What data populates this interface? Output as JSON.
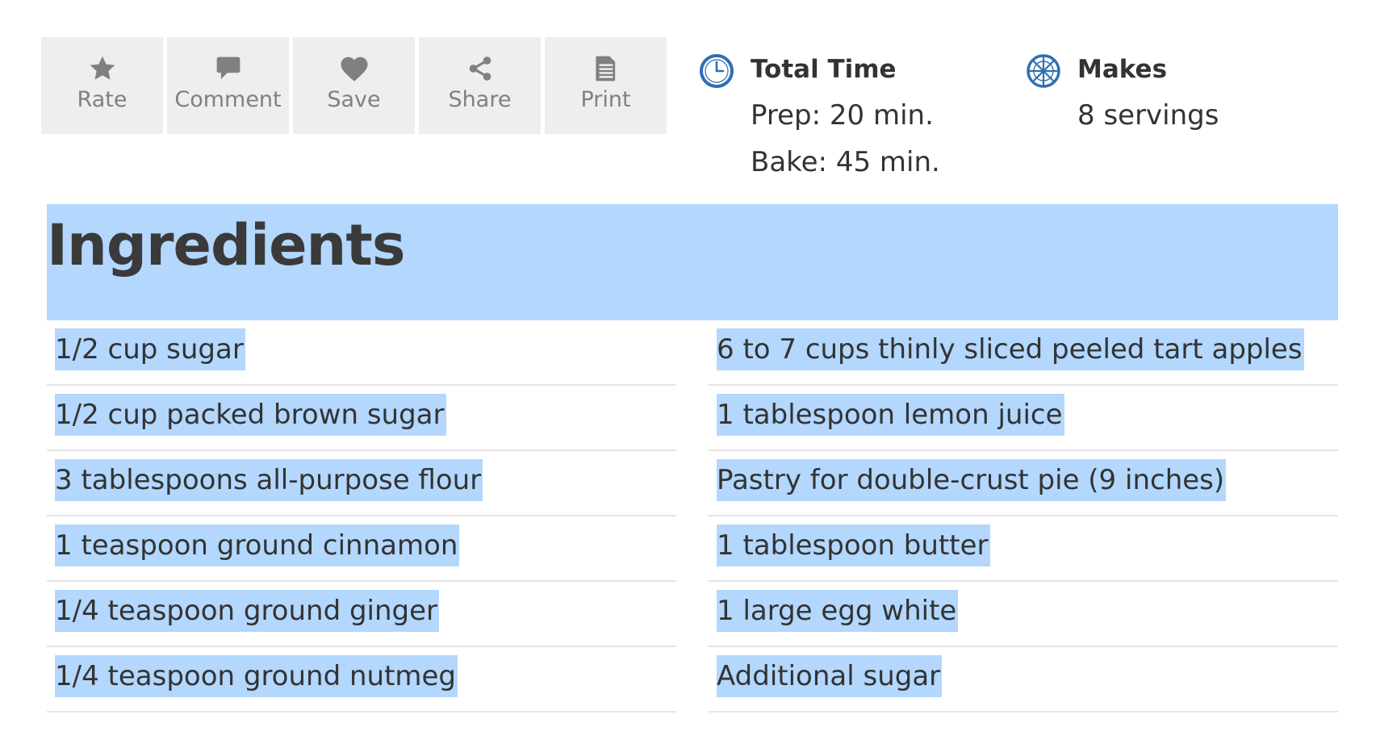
{
  "toolbar": {
    "buttons": [
      {
        "label": "Rate",
        "icon": "star-icon"
      },
      {
        "label": "Comment",
        "icon": "comment-icon"
      },
      {
        "label": "Save",
        "icon": "heart-icon"
      },
      {
        "label": "Share",
        "icon": "share-icon"
      },
      {
        "label": "Print",
        "icon": "print-icon"
      }
    ],
    "icon_color": "#808080",
    "button_bg": "#eeeeee"
  },
  "total_time": {
    "heading": "Total Time",
    "value": "Prep: 20 min. Bake: 45 min.",
    "icon": "clock-icon",
    "icon_color": "#2f6fb3"
  },
  "makes": {
    "heading": "Makes",
    "value": "8 servings",
    "icon": "pie-servings-icon",
    "icon_color": "#2f6fb3"
  },
  "ingredients": {
    "title": "Ingredients",
    "selection_color": "#b3d7fd",
    "left": [
      "1/2 cup sugar",
      "1/2 cup packed brown sugar",
      "3 tablespoons all-purpose flour",
      "1 teaspoon ground cinnamon",
      "1/4 teaspoon ground ginger",
      "1/4 teaspoon ground nutmeg"
    ],
    "right": [
      "6 to 7 cups thinly sliced peeled tart apples",
      "1 tablespoon lemon juice",
      "Pastry for double-crust pie (9 inches)",
      "1 tablespoon butter",
      "1 large egg white",
      "Additional sugar"
    ]
  }
}
